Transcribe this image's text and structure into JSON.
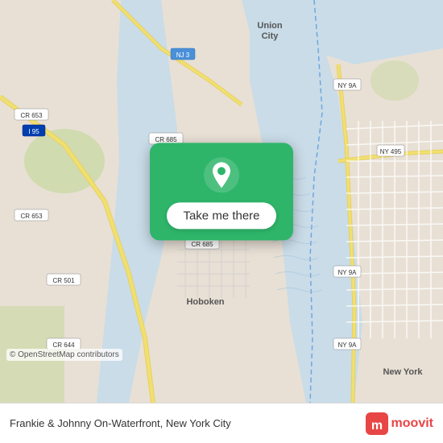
{
  "map": {
    "attribution": "© OpenStreetMap contributors"
  },
  "card": {
    "pin_icon": "location-pin",
    "button_label": "Take me there"
  },
  "bottom_bar": {
    "location_text": "Frankie & Johnny On-Waterfront, New York City",
    "logo_text": "moovit"
  }
}
